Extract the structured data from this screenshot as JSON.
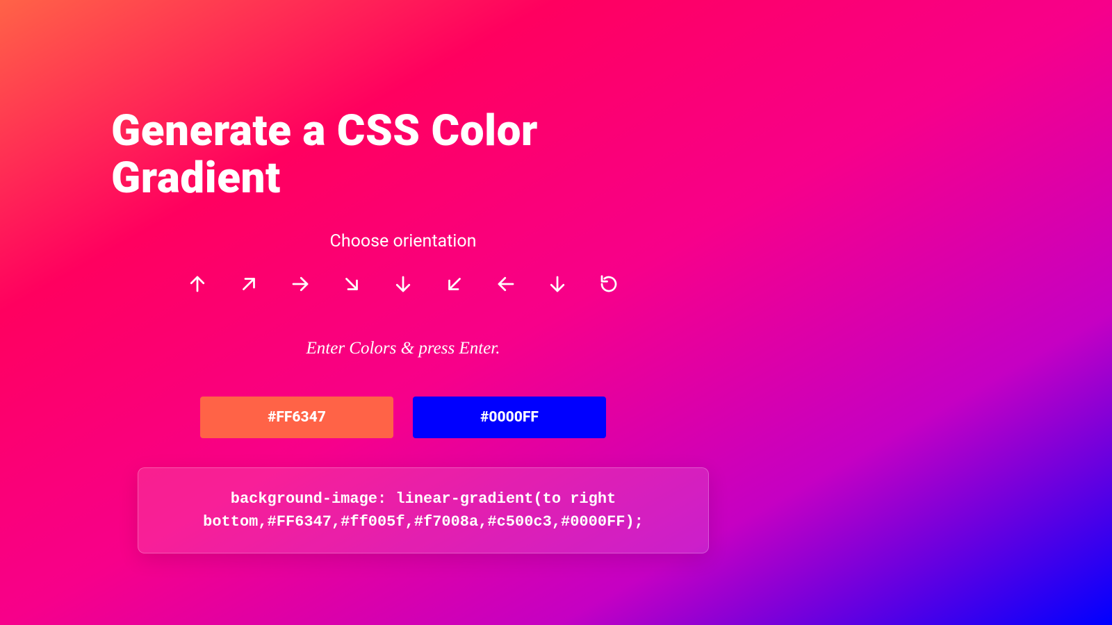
{
  "title": "Generate a CSS Color Gradient",
  "subtitle": "Choose orientation",
  "orientation_buttons": [
    {
      "name": "arrow-up-icon",
      "dir": "up"
    },
    {
      "name": "arrow-up-right-icon",
      "dir": "up-right"
    },
    {
      "name": "arrow-right-icon",
      "dir": "right"
    },
    {
      "name": "arrow-down-right-icon",
      "dir": "down-right"
    },
    {
      "name": "arrow-down-icon",
      "dir": "down"
    },
    {
      "name": "arrow-down-left-icon",
      "dir": "down-left"
    },
    {
      "name": "arrow-left-icon",
      "dir": "left"
    },
    {
      "name": "arrow-down-alt-icon",
      "dir": "down-alt"
    },
    {
      "name": "rotate-icon",
      "dir": "rotate"
    }
  ],
  "instruction": "Enter Colors & press Enter.",
  "colors": {
    "color1": "#FF6347",
    "color2": "#0000FF"
  },
  "css_output": "background-image: linear-gradient(to right bottom,#FF6347,#ff005f,#f7008a,#c500c3,#0000FF);"
}
